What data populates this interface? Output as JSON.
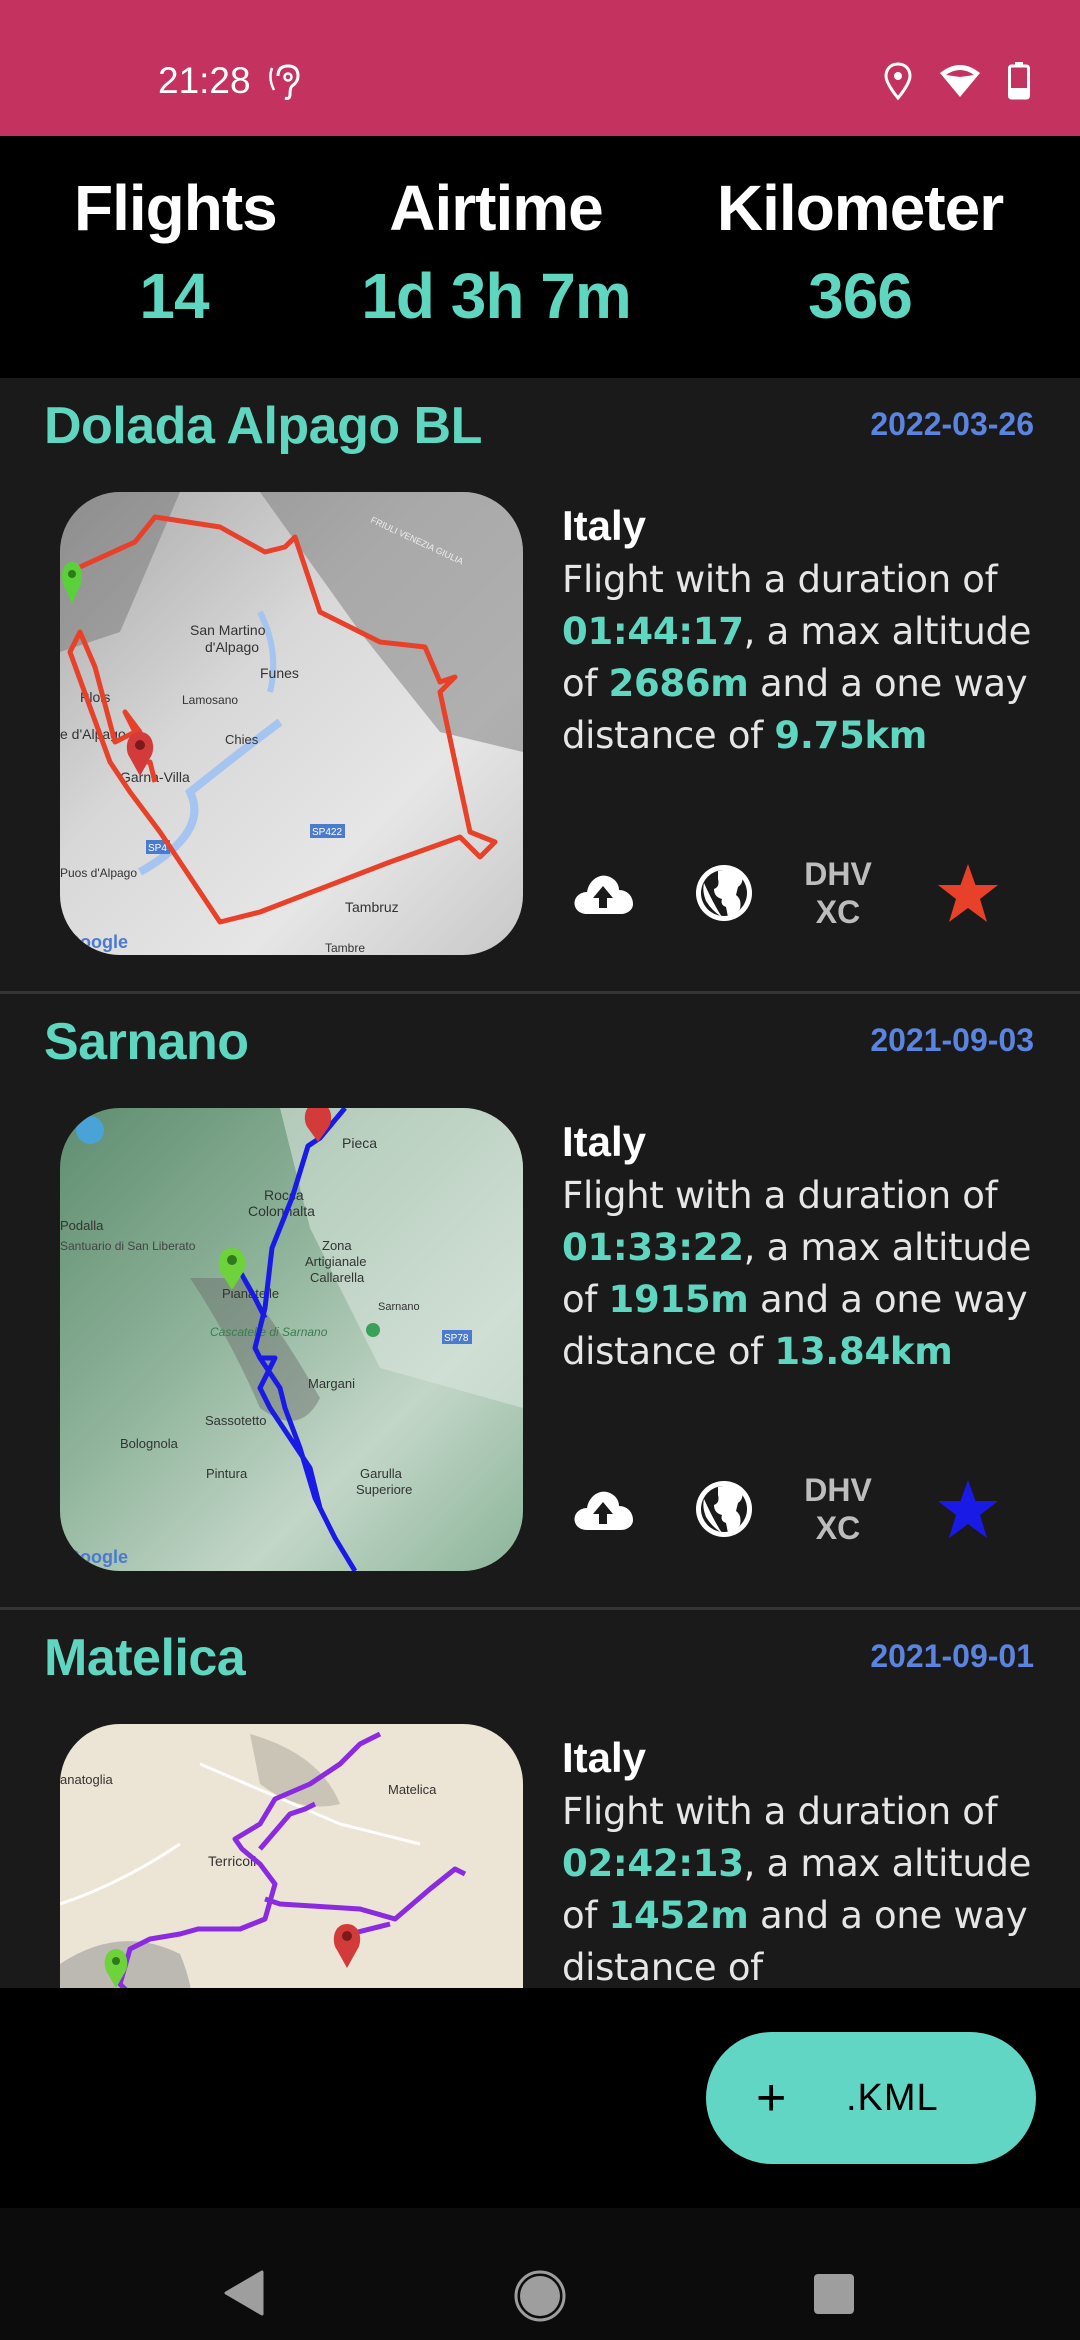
{
  "status_bar": {
    "time": "21:28",
    "background": "#C4335F",
    "icons": [
      "hearing-icon",
      "location-icon",
      "wifi-icon",
      "battery-icon"
    ]
  },
  "stats": {
    "flights": {
      "label": "Flights",
      "value": "14"
    },
    "airtime": {
      "label": "Airtime",
      "value": "1d 3h 7m"
    },
    "kilometer": {
      "label": "Kilometer",
      "value": "366"
    }
  },
  "flights": [
    {
      "title": "Dolada Alpago BL",
      "date": "2022-03-26",
      "country": "Italy",
      "desc_prefix": "Flight with a duration of ",
      "duration": "01:44:17",
      "desc_mid1": ", a max altitude of ",
      "altitude": "2686m",
      "desc_mid2": " and a one way distance of ",
      "distance": "9.75km",
      "track_color": "#E8412A",
      "star_color": "#E8412A",
      "map_labels": [
        "San Martino d'Alpago",
        "Funes",
        "Lamosano",
        "Plois",
        "d'Alpago",
        "Chies",
        "Garna-Villa",
        "SP422",
        "SP4",
        "Puos d'Alpago",
        "Tambruz",
        "Tambre",
        "FRIULI VENEZIA GIULIA",
        "Google"
      ],
      "actions": {
        "upload": "cloud-upload-icon",
        "globe": "globe-icon",
        "dhv_line1": "DHV",
        "dhv_line2": "XC",
        "star": "star-icon"
      }
    },
    {
      "title": "Sarnano",
      "date": "2021-09-03",
      "country": "Italy",
      "desc_prefix": "Flight with a duration of ",
      "duration": "01:33:22",
      "desc_mid1": ", a max altitude of ",
      "altitude": "1915m",
      "desc_mid2": " and a one way distance of ",
      "distance": "13.84km",
      "track_color": "#1A1AE6",
      "star_color": "#1A1AE6",
      "map_labels": [
        "Pieca",
        "Rocca Colonnalta",
        "Podalla",
        "Santuario di San Liberato",
        "Zona Artigianale Callarella",
        "Pianatelle",
        "Sarnano",
        "Cascatelle di Sarnano",
        "SP78",
        "Margani",
        "Sassotetto",
        "Bolognola",
        "Pintura",
        "Garulla Superiore",
        "Google"
      ],
      "actions": {
        "upload": "cloud-upload-icon",
        "globe": "globe-icon",
        "dhv_line1": "DHV",
        "dhv_line2": "XC",
        "star": "star-icon"
      }
    },
    {
      "title": "Matelica",
      "date": "2021-09-01",
      "country": "Italy",
      "desc_prefix": "Flight with a duration of ",
      "duration": "02:42:13",
      "desc_mid1": ", a max altitude of ",
      "altitude": "1452m",
      "desc_mid2": " and a one way distance of ",
      "distance": "",
      "track_color": "#8A2BE2",
      "map_labels": [
        "anatoglia",
        "Matelica",
        "Terricoli"
      ]
    }
  ],
  "fab": {
    "plus": "+",
    "label": ".KML"
  },
  "nav": {
    "back": "back-icon",
    "home": "home-icon",
    "recents": "recents-icon"
  },
  "colors": {
    "accent": "#5FD6C0",
    "date": "#5B84E0",
    "list_bg": "#1A1A1A",
    "header_bg": "#000000",
    "fab_bg": "#62D6C4"
  }
}
